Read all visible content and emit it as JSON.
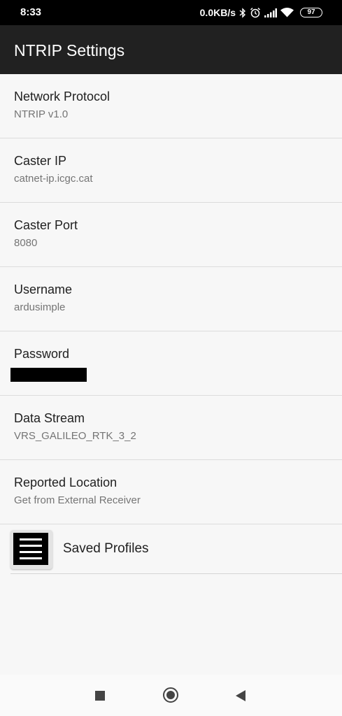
{
  "status_bar": {
    "time": "8:33",
    "net_speed": "0.0KB/s",
    "battery": "97",
    "icons": [
      "bluetooth-icon",
      "alarm-icon",
      "signal-icon",
      "wifi-icon",
      "battery-icon"
    ]
  },
  "app_bar": {
    "title": "NTRIP Settings"
  },
  "preferences": [
    {
      "title": "Network Protocol",
      "summary": "NTRIP v1.0"
    },
    {
      "title": "Caster IP",
      "summary": "catnet-ip.icgc.cat"
    },
    {
      "title": "Caster Port",
      "summary": "8080"
    },
    {
      "title": "Username",
      "summary": "ardusimple"
    },
    {
      "title": "Password",
      "summary": ""
    },
    {
      "title": "Data Stream",
      "summary": "VRS_GALILEO_RTK_3_2"
    },
    {
      "title": "Reported Location",
      "summary": "Get from External Receiver"
    }
  ],
  "saved_profiles": {
    "label": "Saved Profiles",
    "icon": "list-icon"
  },
  "nav_bar": {
    "icons": [
      "recent-apps-icon",
      "home-icon",
      "back-icon"
    ]
  },
  "colors": {
    "app_bar": "#212121",
    "background": "#f7f7f7",
    "summary_text": "#757575"
  }
}
